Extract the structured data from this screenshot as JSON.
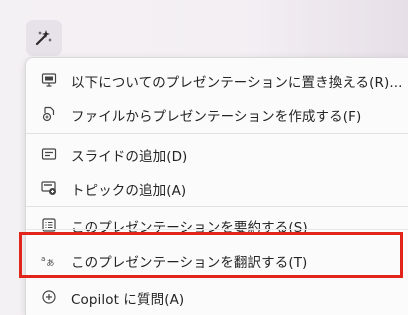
{
  "menu": {
    "items": [
      {
        "label": "以下についてのプレゼンテーションに置き換える(R)...",
        "icon": "presentation-replace-icon"
      },
      {
        "label": "ファイルからプレゼンテーションを作成する(F)",
        "icon": "file-create-icon"
      },
      {
        "label": "スライドの追加(D)",
        "icon": "add-slide-icon"
      },
      {
        "label": "トピックの追加(A)",
        "icon": "add-topic-icon"
      },
      {
        "label": "このプレゼンテーションを要約する(S)",
        "icon": "summarize-icon"
      },
      {
        "label": "このプレゼンテーションを翻訳する(T)",
        "icon": "translate-icon"
      },
      {
        "label": "Copilot に質問(A)",
        "icon": "ask-copilot-icon"
      }
    ]
  },
  "colors": {
    "highlight": "#e1251b"
  }
}
